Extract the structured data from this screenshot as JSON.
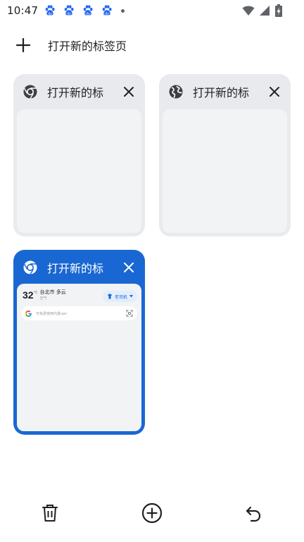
{
  "status_bar": {
    "time": "10:47",
    "notification_icons": [
      "baidu-paw-icon",
      "baidu-paw-icon",
      "baidu-paw-icon",
      "baidu-paw-icon"
    ],
    "right_icons": [
      "wifi-icon",
      "signal-icon",
      "battery-icon"
    ]
  },
  "header": {
    "new_tab_label": "打开新的标签页"
  },
  "tabs": [
    {
      "title": "打开新的标",
      "favicon": "chrome-icon",
      "selected": false
    },
    {
      "title": "打开新的标",
      "favicon": "globe-icon",
      "selected": false
    },
    {
      "title": "打开新的标",
      "favicon": "chrome-icon",
      "selected": true
    }
  ],
  "preview": {
    "temperature": "32",
    "degree_unit": "°C",
    "city": "台北市",
    "weather": "多云",
    "air_quality": "空气",
    "badge_label": "老司机",
    "search_placeholder": "可免费使用内置vpn"
  },
  "bottom_bar": {
    "actions": [
      "delete-icon",
      "add-tab-icon",
      "undo-icon"
    ]
  },
  "colors": {
    "accent_blue": "#1967d2",
    "card_gray": "#e8eaed",
    "card_body": "#f1f3f4",
    "text_primary": "#202124"
  }
}
